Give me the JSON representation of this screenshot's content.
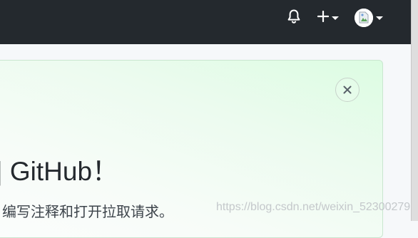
{
  "header": {
    "notifications_icon": "bell-icon",
    "create_icon": "plus-icon",
    "avatar_icon": "avatar-image",
    "background_color": "#24292e"
  },
  "welcome_card": {
    "heading": "| GitHub！",
    "subtext": "编写注释和打开拉取请求。",
    "close_icon": "close-icon",
    "accent_color": "#dcfce2"
  },
  "watermark": {
    "text": "https://blog.csdn.net/weixin_52300279"
  }
}
